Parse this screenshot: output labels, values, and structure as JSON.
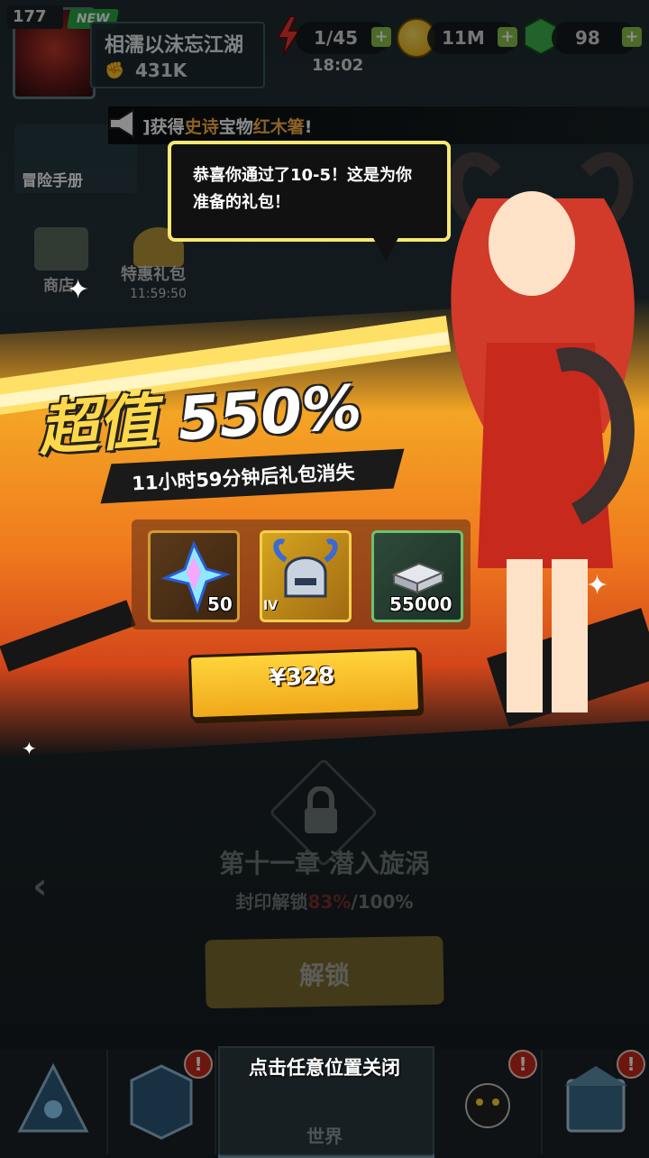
{
  "player": {
    "level": "177",
    "new_tag": "NEW",
    "name": "相濡以沫忘江湖",
    "power": "431K"
  },
  "resources": {
    "stamina": "1/45",
    "gold": "11M",
    "gems": "98",
    "timer": "18:02"
  },
  "side": {
    "adventure_book": "冒险手册",
    "store_label": "商店",
    "special_pack": "特惠礼包",
    "special_pack_timer": "11:59:50"
  },
  "announcement": {
    "prefix": "]获得",
    "epic": "史诗",
    "mid": "宝物",
    "item": "红木箸",
    "suffix": "!"
  },
  "popup": {
    "speech": "恭喜你通过了10-5！这是为你准备的礼包！",
    "value_label": "超值",
    "value_percent": "550%",
    "timer_text": "11小时59分钟后礼包消失",
    "items": [
      {
        "icon": "crystal-shard-icon",
        "qty": "50",
        "tier": ""
      },
      {
        "icon": "horned-helmet-icon",
        "qty": "",
        "tier": "IV"
      },
      {
        "icon": "silver-ingot-icon",
        "qty": "55000",
        "tier": ""
      }
    ],
    "price": "¥328",
    "close_hint": "点击任意位置关闭"
  },
  "chapter": {
    "title": "第十一章 潜入旋涡",
    "seal_prefix": "封印解锁",
    "seal_progress": "83%",
    "seal_total": "/100%",
    "unlock_button": "解锁"
  },
  "nav": {
    "world_label": "世界",
    "badge_mark": "!"
  },
  "colors": {
    "banner_orange": "#f07a1e",
    "buy_yellow": "#ffd43b",
    "speech_border": "#f6e873",
    "badge_red": "#c7281e"
  }
}
